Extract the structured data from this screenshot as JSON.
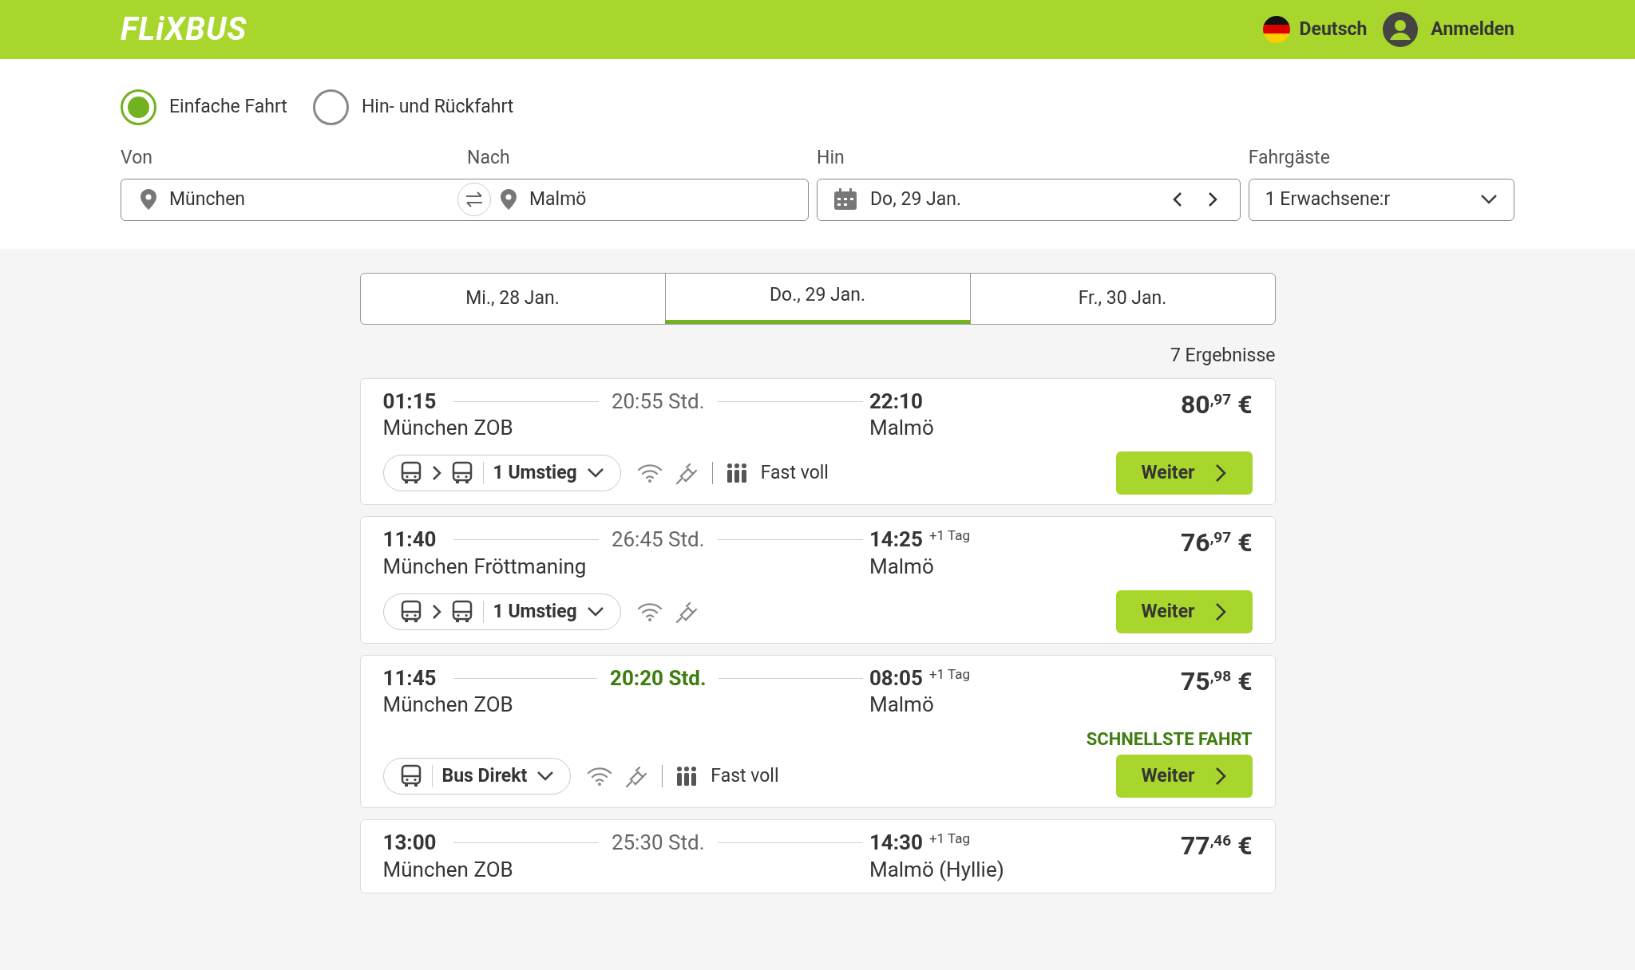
{
  "header": {
    "logo": "FLiXBUS",
    "language": "Deutsch",
    "login": "Anmelden"
  },
  "trip_types": [
    {
      "label": "Einfache Fahrt",
      "selected": true
    },
    {
      "label": "Hin- und Rückfahrt",
      "selected": false
    }
  ],
  "search": {
    "from_label": "Von",
    "from": "München",
    "to_label": "Nach",
    "to": "Malmö",
    "date_label": "Hin",
    "date": "Do, 29 Jan.",
    "passengers_label": "Fahrgäste",
    "passengers": "1 Erwachsene:r"
  },
  "date_tabs": [
    {
      "label": "Mi., 28 Jan.",
      "selected": false
    },
    {
      "label": "Do., 29 Jan.",
      "selected": true
    },
    {
      "label": "Fr., 30 Jan.",
      "selected": false
    }
  ],
  "results_count": "7 Ergebnisse",
  "results": [
    {
      "departure": "01:15",
      "duration": "20:55 Std.",
      "fastest": false,
      "arrival": "22:10",
      "from": "München ZOB",
      "to": "Malmö",
      "price": "80",
      "cents": ",97",
      "currency": "€",
      "route": {
        "kind": "transfer",
        "label": "1 Umstieg"
      },
      "occupancy": "Fast voll",
      "button": "Weiter"
    },
    {
      "departure": "11:40",
      "duration": "26:45 Std.",
      "fastest": false,
      "arrival": "14:25",
      "next_day": "+1 Tag",
      "from": "München Fröttmaning",
      "to": "Malmö",
      "price": "76",
      "cents": ",97",
      "currency": "€",
      "route": {
        "kind": "transfer",
        "label": "1 Umstieg"
      },
      "button": "Weiter"
    },
    {
      "departure": "11:45",
      "duration": "20:20 Std.",
      "fastest": true,
      "arrival": "08:05",
      "next_day": "+1 Tag",
      "from": "München ZOB",
      "to": "Malmö",
      "price": "75",
      "cents": ",98",
      "currency": "€",
      "badge": "SCHNELLSTE FAHRT",
      "route": {
        "kind": "direct",
        "label": "Bus Direkt"
      },
      "occupancy": "Fast voll",
      "button": "Weiter"
    },
    {
      "departure": "13:00",
      "duration": "25:30 Std.",
      "fastest": false,
      "arrival": "14:30",
      "next_day": "+1 Tag",
      "from": "München ZOB",
      "to": "Malmö (Hyllie)",
      "price": "77",
      "cents": ",46",
      "currency": "€"
    }
  ]
}
